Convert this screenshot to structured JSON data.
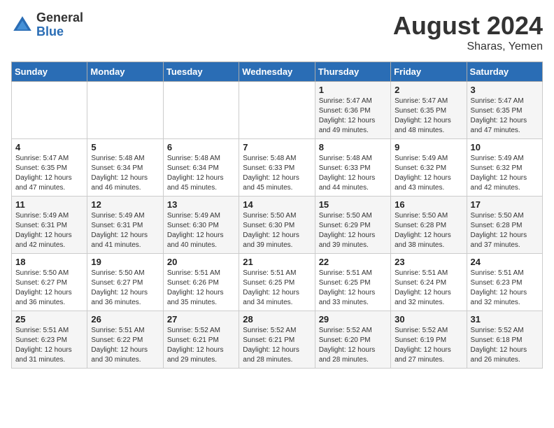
{
  "logo": {
    "general": "General",
    "blue": "Blue"
  },
  "title": {
    "month_year": "August 2024",
    "location": "Sharas, Yemen"
  },
  "weekdays": [
    "Sunday",
    "Monday",
    "Tuesday",
    "Wednesday",
    "Thursday",
    "Friday",
    "Saturday"
  ],
  "weeks": [
    [
      {
        "day": "",
        "info": ""
      },
      {
        "day": "",
        "info": ""
      },
      {
        "day": "",
        "info": ""
      },
      {
        "day": "",
        "info": ""
      },
      {
        "day": "1",
        "info": "Sunrise: 5:47 AM\nSunset: 6:36 PM\nDaylight: 12 hours and 49 minutes."
      },
      {
        "day": "2",
        "info": "Sunrise: 5:47 AM\nSunset: 6:35 PM\nDaylight: 12 hours and 48 minutes."
      },
      {
        "day": "3",
        "info": "Sunrise: 5:47 AM\nSunset: 6:35 PM\nDaylight: 12 hours and 47 minutes."
      }
    ],
    [
      {
        "day": "4",
        "info": "Sunrise: 5:47 AM\nSunset: 6:35 PM\nDaylight: 12 hours and 47 minutes."
      },
      {
        "day": "5",
        "info": "Sunrise: 5:48 AM\nSunset: 6:34 PM\nDaylight: 12 hours and 46 minutes."
      },
      {
        "day": "6",
        "info": "Sunrise: 5:48 AM\nSunset: 6:34 PM\nDaylight: 12 hours and 45 minutes."
      },
      {
        "day": "7",
        "info": "Sunrise: 5:48 AM\nSunset: 6:33 PM\nDaylight: 12 hours and 45 minutes."
      },
      {
        "day": "8",
        "info": "Sunrise: 5:48 AM\nSunset: 6:33 PM\nDaylight: 12 hours and 44 minutes."
      },
      {
        "day": "9",
        "info": "Sunrise: 5:49 AM\nSunset: 6:32 PM\nDaylight: 12 hours and 43 minutes."
      },
      {
        "day": "10",
        "info": "Sunrise: 5:49 AM\nSunset: 6:32 PM\nDaylight: 12 hours and 42 minutes."
      }
    ],
    [
      {
        "day": "11",
        "info": "Sunrise: 5:49 AM\nSunset: 6:31 PM\nDaylight: 12 hours and 42 minutes."
      },
      {
        "day": "12",
        "info": "Sunrise: 5:49 AM\nSunset: 6:31 PM\nDaylight: 12 hours and 41 minutes."
      },
      {
        "day": "13",
        "info": "Sunrise: 5:49 AM\nSunset: 6:30 PM\nDaylight: 12 hours and 40 minutes."
      },
      {
        "day": "14",
        "info": "Sunrise: 5:50 AM\nSunset: 6:30 PM\nDaylight: 12 hours and 39 minutes."
      },
      {
        "day": "15",
        "info": "Sunrise: 5:50 AM\nSunset: 6:29 PM\nDaylight: 12 hours and 39 minutes."
      },
      {
        "day": "16",
        "info": "Sunrise: 5:50 AM\nSunset: 6:28 PM\nDaylight: 12 hours and 38 minutes."
      },
      {
        "day": "17",
        "info": "Sunrise: 5:50 AM\nSunset: 6:28 PM\nDaylight: 12 hours and 37 minutes."
      }
    ],
    [
      {
        "day": "18",
        "info": "Sunrise: 5:50 AM\nSunset: 6:27 PM\nDaylight: 12 hours and 36 minutes."
      },
      {
        "day": "19",
        "info": "Sunrise: 5:50 AM\nSunset: 6:27 PM\nDaylight: 12 hours and 36 minutes."
      },
      {
        "day": "20",
        "info": "Sunrise: 5:51 AM\nSunset: 6:26 PM\nDaylight: 12 hours and 35 minutes."
      },
      {
        "day": "21",
        "info": "Sunrise: 5:51 AM\nSunset: 6:25 PM\nDaylight: 12 hours and 34 minutes."
      },
      {
        "day": "22",
        "info": "Sunrise: 5:51 AM\nSunset: 6:25 PM\nDaylight: 12 hours and 33 minutes."
      },
      {
        "day": "23",
        "info": "Sunrise: 5:51 AM\nSunset: 6:24 PM\nDaylight: 12 hours and 32 minutes."
      },
      {
        "day": "24",
        "info": "Sunrise: 5:51 AM\nSunset: 6:23 PM\nDaylight: 12 hours and 32 minutes."
      }
    ],
    [
      {
        "day": "25",
        "info": "Sunrise: 5:51 AM\nSunset: 6:23 PM\nDaylight: 12 hours and 31 minutes."
      },
      {
        "day": "26",
        "info": "Sunrise: 5:51 AM\nSunset: 6:22 PM\nDaylight: 12 hours and 30 minutes."
      },
      {
        "day": "27",
        "info": "Sunrise: 5:52 AM\nSunset: 6:21 PM\nDaylight: 12 hours and 29 minutes."
      },
      {
        "day": "28",
        "info": "Sunrise: 5:52 AM\nSunset: 6:21 PM\nDaylight: 12 hours and 28 minutes."
      },
      {
        "day": "29",
        "info": "Sunrise: 5:52 AM\nSunset: 6:20 PM\nDaylight: 12 hours and 28 minutes."
      },
      {
        "day": "30",
        "info": "Sunrise: 5:52 AM\nSunset: 6:19 PM\nDaylight: 12 hours and 27 minutes."
      },
      {
        "day": "31",
        "info": "Sunrise: 5:52 AM\nSunset: 6:18 PM\nDaylight: 12 hours and 26 minutes."
      }
    ]
  ]
}
